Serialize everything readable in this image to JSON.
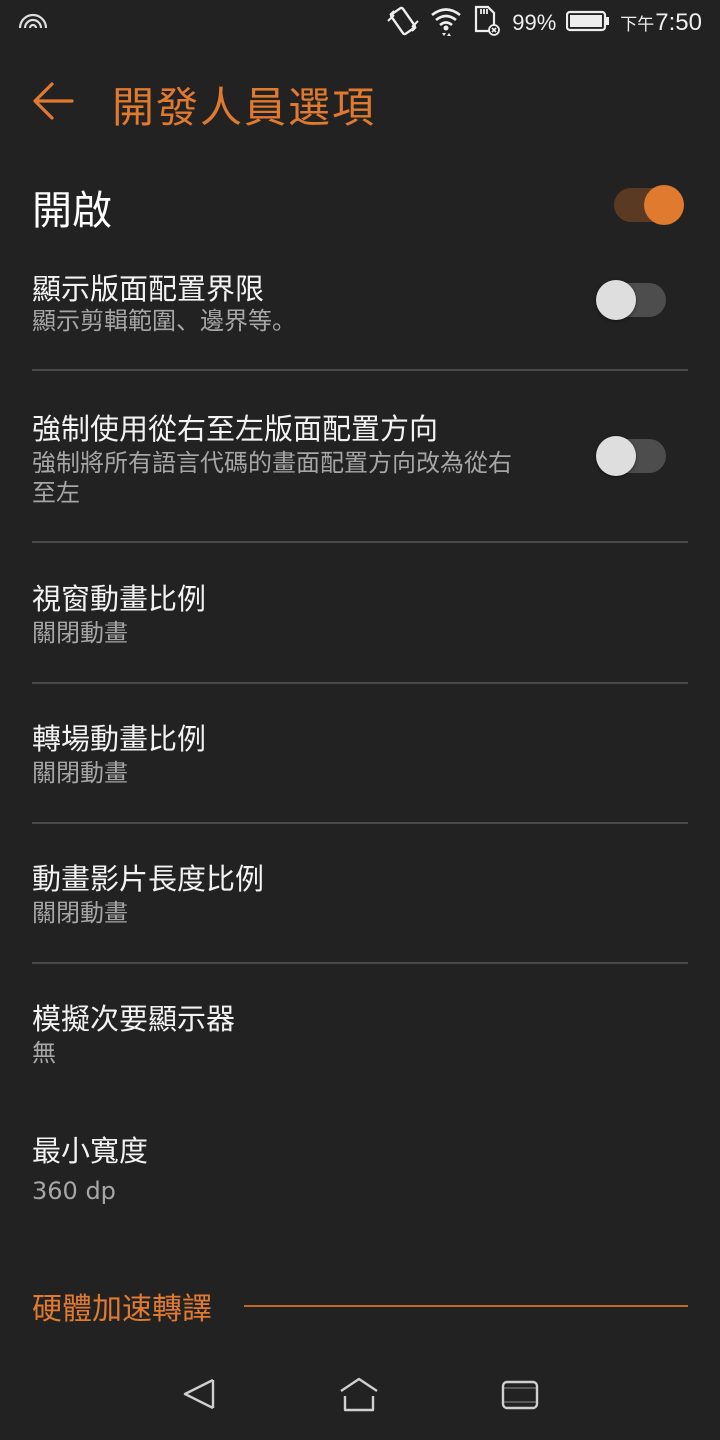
{
  "status_bar": {
    "battery_percent": "99%",
    "time_ampm": "下午",
    "time": "7:50",
    "icons": [
      "hotspot-icon",
      "vibrate-icon",
      "wifi-icon",
      "sd-card-icon",
      "battery-icon"
    ]
  },
  "header": {
    "title": "開發人員選項",
    "back_icon": "arrow-back-icon"
  },
  "master_switch": {
    "label": "開啟",
    "on": true
  },
  "settings": [
    {
      "title": "顯示版面配置界限",
      "summary": "顯示剪輯範圍、邊界等。",
      "toggle": false
    },
    {
      "title": "強制使用從右至左版面配置方向",
      "summary_line1": "強制將所有語言代碼的畫面配置方向改為從右",
      "summary_line2": "至左",
      "toggle": false
    },
    {
      "title": "視窗動畫比例",
      "summary": "關閉動畫"
    },
    {
      "title": "轉場動畫比例",
      "summary": "關閉動畫"
    },
    {
      "title": "動畫影片長度比例",
      "summary": "關閉動畫"
    },
    {
      "title": "模擬次要顯示器",
      "summary": "無"
    },
    {
      "title": "最小寬度",
      "summary": "360 dp"
    }
  ],
  "section": {
    "label": "硬體加速轉譯"
  },
  "nav_bar": {
    "icons": [
      "nav-back-icon",
      "nav-home-icon",
      "nav-recents-icon"
    ]
  },
  "colors": {
    "accent": "#e07a2e",
    "background": "#222222",
    "divider": "#4a4a4a",
    "summary_text": "#a6a6a6"
  }
}
